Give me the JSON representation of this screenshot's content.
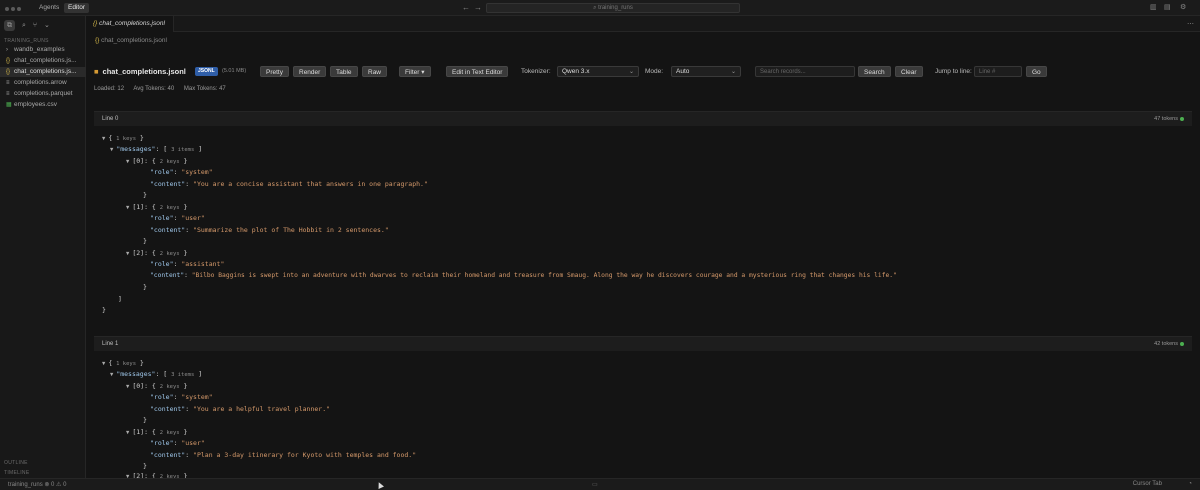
{
  "topbar": {
    "tabs": [
      "Agents",
      "Editor"
    ],
    "search": "training_runs"
  },
  "sidebar": {
    "section": "TRAINING_RUNS",
    "items": [
      {
        "icon": "›",
        "label": "wandb_examples"
      },
      {
        "icon": "{}",
        "label": "chat_completions.js..."
      },
      {
        "icon": "{}",
        "label": "chat_completions.js..."
      },
      {
        "icon": "≡",
        "label": "completions.arrow"
      },
      {
        "icon": "≡",
        "label": "completions.parquet"
      },
      {
        "icon": "▦",
        "label": "employees.csv"
      }
    ],
    "outline": "OUTLINE",
    "timeline": "TIMELINE"
  },
  "editor": {
    "tab_label": "chat_completions.jsonl",
    "breadcrumb": "chat_completions.jsonl"
  },
  "toolbar": {
    "file_name": "chat_completions.jsonl",
    "format_badge": "JSONL",
    "file_size": "(5.01 MB)",
    "buttons": {
      "pretty": "Pretty",
      "render": "Render",
      "table": "Table",
      "raw": "Raw",
      "filter": "Filter",
      "edit_text": "Edit in Text Editor",
      "search": "Search",
      "clear": "Clear",
      "go": "Go"
    },
    "tokenizer_label": "Tokenizer:",
    "tokenizer_value": "Qwen 3.x",
    "mode_label": "Mode:",
    "mode_value": "Auto",
    "search_placeholder": "Search records...",
    "jump_label": "Jump to line:",
    "jump_placeholder": "Line #"
  },
  "stats": {
    "loaded": "Loaded: 12",
    "avg_tokens": "Avg Tokens: 40",
    "max_tokens": "Max Tokens: 47"
  },
  "records": [
    {
      "line_label": "Line 0",
      "tokens": "47 tokens",
      "root_meta": "1 keys",
      "messages_meta": "3 items",
      "messages": [
        {
          "index": "[0]",
          "meta": "2 keys",
          "role": "\"system\"",
          "content": "\"You are a concise assistant that answers in one paragraph.\""
        },
        {
          "index": "[1]",
          "meta": "2 keys",
          "role": "\"user\"",
          "content": "\"Summarize the plot of The Hobbit in 2 sentences.\""
        },
        {
          "index": "[2]",
          "meta": "2 keys",
          "role": "\"assistant\"",
          "content": "\"Bilbo Baggins is swept into an adventure with dwarves to reclaim their homeland and treasure from Smaug. Along the way he discovers courage and a mysterious ring that changes his life.\""
        }
      ]
    },
    {
      "line_label": "Line 1",
      "tokens": "42 tokens",
      "root_meta": "1 keys",
      "messages_meta": "3 items",
      "messages": [
        {
          "index": "[0]",
          "meta": "2 keys",
          "role": "\"system\"",
          "content": "\"You are a helpful travel planner.\""
        },
        {
          "index": "[1]",
          "meta": "2 keys",
          "role": "\"user\"",
          "content": "\"Plan a 3-day itinerary for Kyoto with temples and food.\""
        },
        {
          "index": "[2]",
          "meta": "2 keys"
        }
      ]
    }
  ],
  "json_keys": {
    "messages": "\"messages\"",
    "role": "\"role\"",
    "content": "\"content\""
  },
  "statusbar": {
    "left": "training_runs  ⊗ 0  ⚠ 0",
    "right": "Cursor Tab"
  }
}
